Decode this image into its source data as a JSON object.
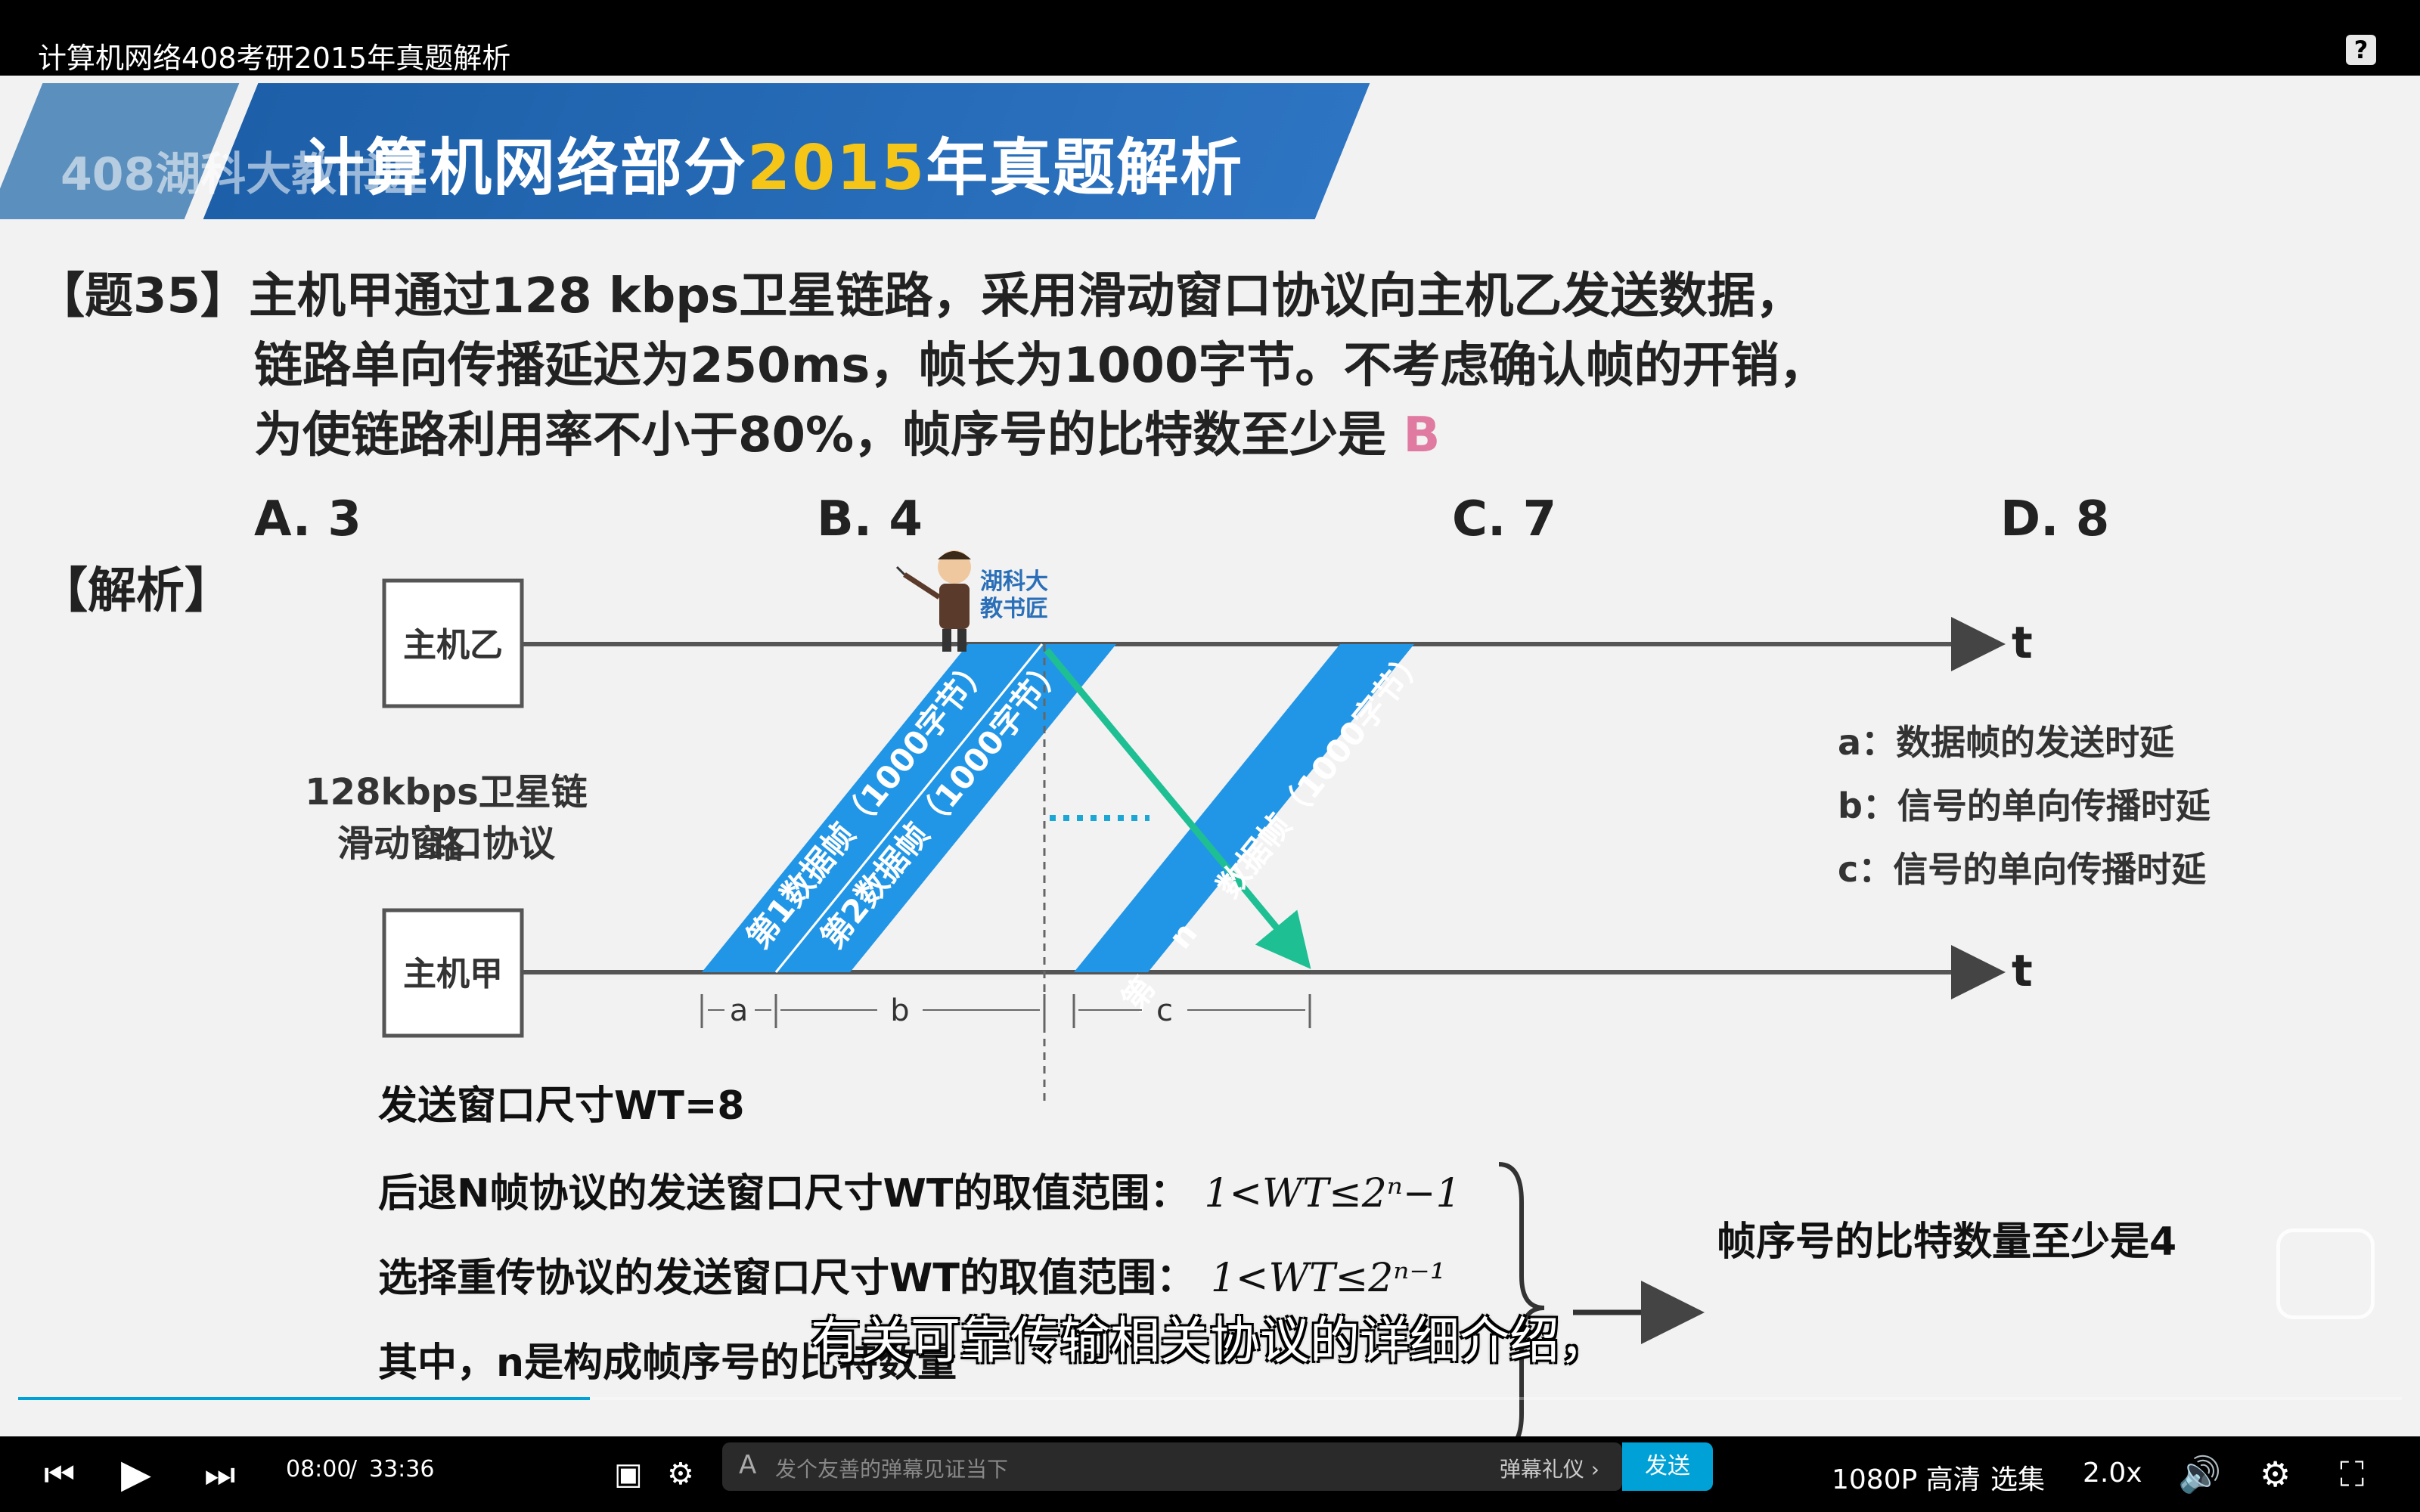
{
  "window": {
    "title": "计算机网络408考研2015年真题解析",
    "help_label": "?"
  },
  "slide": {
    "banner_prefix": "计算机网络部分",
    "banner_year": "2015",
    "banner_suffix": "年真题解析",
    "banner_ghost": "408湖科大教书匠",
    "question_lines": [
      "【题35】主机甲通过128 kbps卫星链路，采用滑动窗口协议向主机乙发送数据，",
      "链路单向传播延迟为250ms，帧长为1000字节。不考虑确认帧的开销，",
      "为使链路利用率不小于80%，帧序号的比特数至少是"
    ],
    "answer_mark": "B",
    "options": [
      "A. 3",
      "B. 4",
      "C. 7",
      "D. 8"
    ],
    "jiexi_label": "【解析】",
    "teacher_label_1": "湖科大",
    "teacher_label_2": "教书匠",
    "host_b": "主机乙",
    "host_a": "主机甲",
    "time_axis": "t",
    "link_label_1": "128kbps卫星链路",
    "link_label_2": "滑动窗口协议",
    "frame_1": "第1数据帧（1000字节）",
    "frame_2": "第2数据帧（1000字节）",
    "frame_n_1": "第",
    "frame_n_2": "n",
    "frame_n_3": "数据帧（1000字节）",
    "dim_a": "a",
    "dim_b": "b",
    "dim_c": "c",
    "legend": [
      "a：数据帧的发送时延",
      "b：信号的单向传播时延",
      "c：信号的单向传播时延"
    ],
    "formula_1": "发送窗口尺寸WT=8",
    "formula_2": "后退N帧协议的发送窗口尺寸WT的取值范围：",
    "formula_2_math": "1<WT≤2ⁿ−1",
    "formula_3": "选择重传协议的发送窗口尺寸WT的取值范围：",
    "formula_3_math": "1<WT≤2ⁿ⁻¹",
    "formula_4": "其中，n是构成帧序号的比特数量",
    "conclusion": "帧序号的比特数量至少是4"
  },
  "player": {
    "subtitle": "有关可靠传输相关协议的详细介绍，",
    "progress_fraction": 0.24,
    "time_current": "08:00",
    "time_sep": "/",
    "time_total": "33:36",
    "danmaku_placeholder": "发个友善的弹幕见证当下",
    "danmaku_gift": "弹幕礼仪 ›",
    "send_label": "发送",
    "quality": "1080P 高清",
    "episodes": "选集",
    "speed": "2.0x"
  }
}
